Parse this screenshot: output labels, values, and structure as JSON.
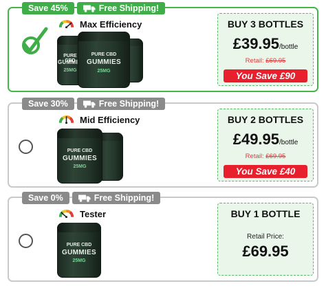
{
  "colors": {
    "accent_green": "#3fae49",
    "save_red": "#e8202e",
    "retail_red": "#e23b3b",
    "muted_badge": "#8a8a8a"
  },
  "offers": [
    {
      "selected": true,
      "save_badge": "Save 45%",
      "shipping_badge": "Free Shipping!",
      "efficiency": "Max Efficiency",
      "title": "BUY 3 BOTTLES",
      "price": "£39.95",
      "per_unit": "/bottle",
      "retail_label": "Retail:",
      "retail_price": "£69.95",
      "you_save": "You Save £90",
      "jar_text": {
        "line1": "PURE CBD",
        "line2": "GUMMIES",
        "line3": "25MG"
      },
      "icons": [
        "checkmark-icon",
        "truck-icon",
        "gauge-icon"
      ]
    },
    {
      "selected": false,
      "save_badge": "Save 30%",
      "shipping_badge": "Free Shipping!",
      "efficiency": "Mid Efficiency",
      "title": "BUY 2 BOTTLES",
      "price": "£49.95",
      "per_unit": "/bottle",
      "retail_label": "Retail:",
      "retail_price": "£69.95",
      "you_save": "You Save £40",
      "jar_text": {
        "line1": "PURE CBD",
        "line2": "GUMMIES",
        "line3": "25MG"
      },
      "icons": [
        "radio-icon",
        "truck-icon",
        "gauge-icon"
      ]
    },
    {
      "selected": false,
      "save_badge": "Save 0%",
      "shipping_badge": "Free Shipping!",
      "efficiency": "Tester",
      "title": "BUY 1 BOTTLE",
      "retail_label": "Retail Price:",
      "price": "£69.95",
      "jar_text": {
        "line1": "PURE CBD",
        "line2": "GUMMIES",
        "line3": "25MG"
      },
      "icons": [
        "radio-icon",
        "truck-icon",
        "gauge-icon"
      ]
    }
  ]
}
